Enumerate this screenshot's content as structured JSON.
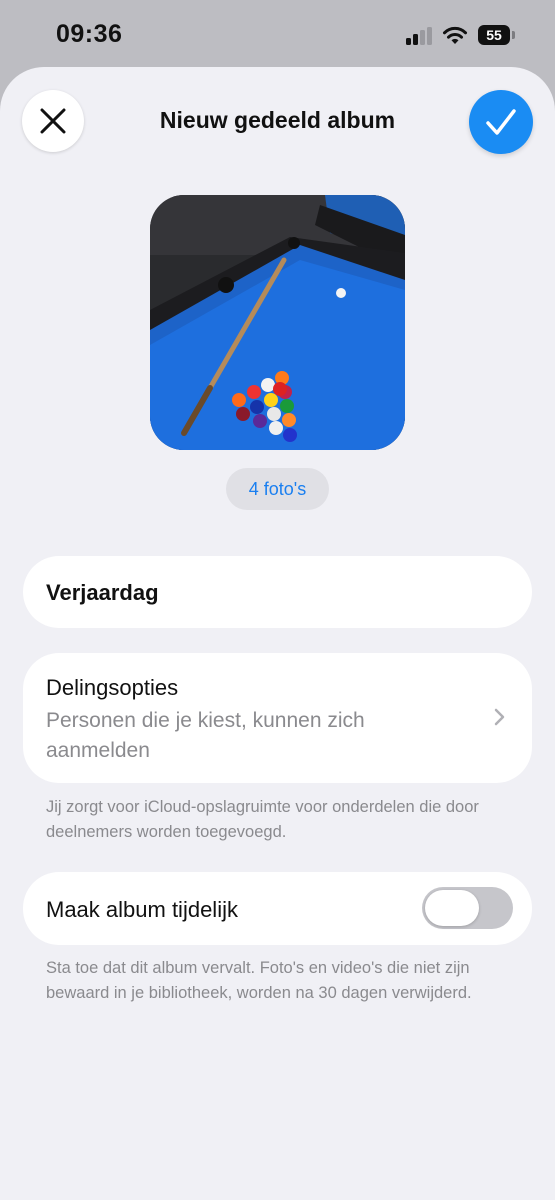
{
  "status_bar": {
    "time": "09:36",
    "battery": "55"
  },
  "header": {
    "title": "Nieuw gedeeld album",
    "close_icon": "close-icon",
    "done_icon": "checkmark-icon"
  },
  "cover": {
    "photo_count": "4 foto's",
    "image": "pool-table-photo"
  },
  "album_name": {
    "value": "Verjaardag"
  },
  "sharing": {
    "title": "Delingsopties",
    "subtitle": "Personen die je kiest, kunnen zich aanmelden",
    "footnote": "Jij zorgt voor iCloud-opslagruimte voor onderdelen die door deelnemers worden toegevoegd."
  },
  "temporary": {
    "label": "Maak album tijdelijk",
    "enabled": false,
    "footnote": "Sta toe dat dit album vervalt. Foto's en video's die niet zijn bewaard in je bibliotheek, worden na 30 dagen verwijderd."
  },
  "colors": {
    "accent": "#1a8cf3",
    "background": "#f0f0f5",
    "toggle_off": "#c6c6cb"
  }
}
